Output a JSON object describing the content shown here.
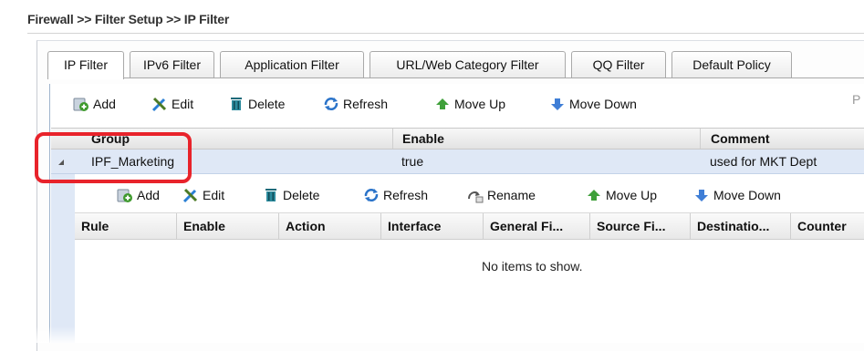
{
  "breadcrumb": "Firewall >> Filter Setup >> IP Filter",
  "tabs": [
    {
      "label": "IP Filter",
      "active": true
    },
    {
      "label": "IPv6 Filter",
      "active": false
    },
    {
      "label": "Application Filter",
      "active": false
    },
    {
      "label": "URL/Web Category Filter",
      "active": false
    },
    {
      "label": "QQ Filter",
      "active": false
    },
    {
      "label": "Default Policy",
      "active": false
    }
  ],
  "group_toolbar": {
    "add": "Add",
    "edit": "Edit",
    "delete": "Delete",
    "refresh": "Refresh",
    "move_up": "Move Up",
    "move_down": "Move Down",
    "cut_text": "P"
  },
  "group_table": {
    "columns": [
      "Group",
      "Enable",
      "Comment"
    ],
    "rows": [
      {
        "group": "IPF_Marketing",
        "enable": "true",
        "comment": "used for MKT Dept"
      }
    ]
  },
  "rule_toolbar": {
    "add": "Add",
    "edit": "Edit",
    "delete": "Delete",
    "refresh": "Refresh",
    "rename": "Rename",
    "move_up": "Move Up",
    "move_down": "Move Down"
  },
  "rule_table": {
    "columns": [
      "Rule",
      "Enable",
      "Action",
      "Interface",
      "General Fi...",
      "Source Fi...",
      "Destinatio...",
      "Counter"
    ],
    "empty_message": "No items to show."
  },
  "colors": {
    "selected_row": "#dfe8f6",
    "highlight_box": "#e8232b"
  }
}
